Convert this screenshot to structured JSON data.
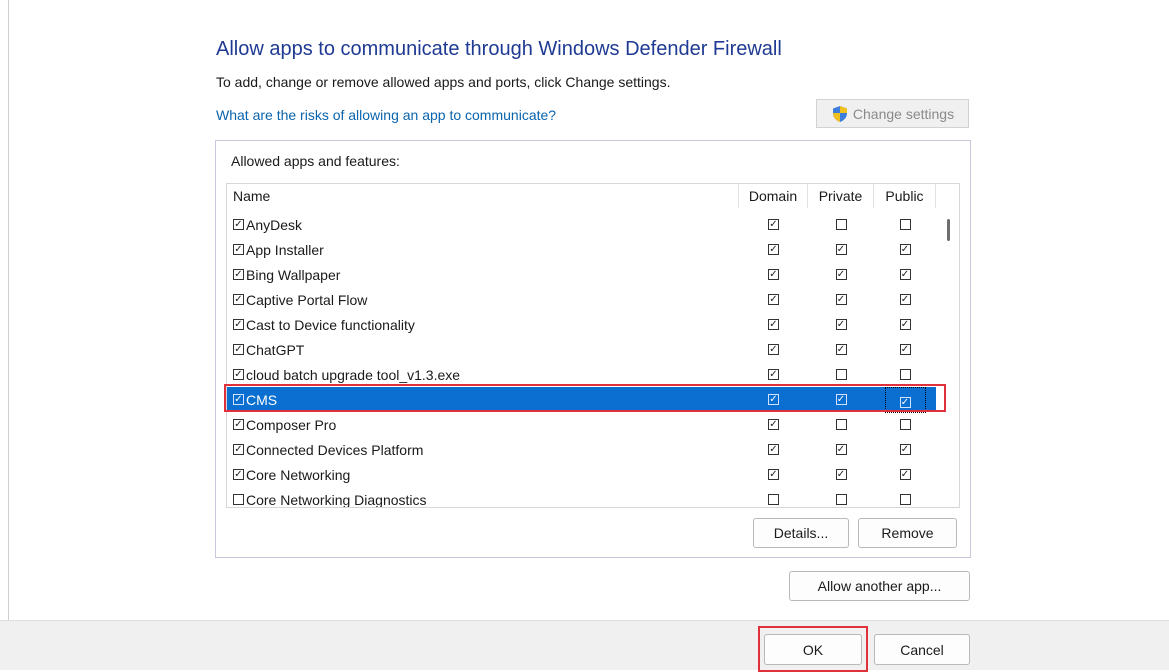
{
  "heading": "Allow apps to communicate through Windows Defender Firewall",
  "subtitle": "To add, change or remove allowed apps and ports, click Change settings.",
  "risk_link": "What are the risks of allowing an app to communicate?",
  "change_settings_label": "Change settings",
  "group_label": "Allowed apps and features:",
  "columns": {
    "name": "Name",
    "domain": "Domain",
    "private": "Private",
    "public": "Public"
  },
  "apps": [
    {
      "name": "AnyDesk",
      "enabled": true,
      "domain": true,
      "private": false,
      "public": false
    },
    {
      "name": "App Installer",
      "enabled": true,
      "domain": true,
      "private": true,
      "public": true
    },
    {
      "name": "Bing Wallpaper",
      "enabled": true,
      "domain": true,
      "private": true,
      "public": true
    },
    {
      "name": "Captive Portal Flow",
      "enabled": true,
      "domain": true,
      "private": true,
      "public": true
    },
    {
      "name": "Cast to Device functionality",
      "enabled": true,
      "domain": true,
      "private": true,
      "public": true
    },
    {
      "name": "ChatGPT",
      "enabled": true,
      "domain": true,
      "private": true,
      "public": true
    },
    {
      "name": "cloud batch upgrade tool_v1.3.exe",
      "enabled": true,
      "domain": true,
      "private": false,
      "public": false
    },
    {
      "name": "CMS",
      "enabled": true,
      "domain": true,
      "private": true,
      "public": true,
      "selected": true
    },
    {
      "name": "Composer Pro",
      "enabled": true,
      "domain": true,
      "private": false,
      "public": false
    },
    {
      "name": "Connected Devices Platform",
      "enabled": true,
      "domain": true,
      "private": true,
      "public": true
    },
    {
      "name": "Core Networking",
      "enabled": true,
      "domain": true,
      "private": true,
      "public": true
    },
    {
      "name": "Core Networking Diagnostics",
      "enabled": false,
      "domain": false,
      "private": false,
      "public": false
    }
  ],
  "buttons": {
    "details": "Details...",
    "remove": "Remove",
    "allow_another": "Allow another app...",
    "ok": "OK",
    "cancel": "Cancel"
  },
  "colors": {
    "heading": "#1f3a93",
    "link": "#0a64ad",
    "selection": "#0a6fd1",
    "highlight_box": "#e0303c"
  },
  "icons": {
    "change_settings": "uac-shield-icon",
    "check": "checkbox-checked",
    "uncheck": "checkbox-empty"
  }
}
